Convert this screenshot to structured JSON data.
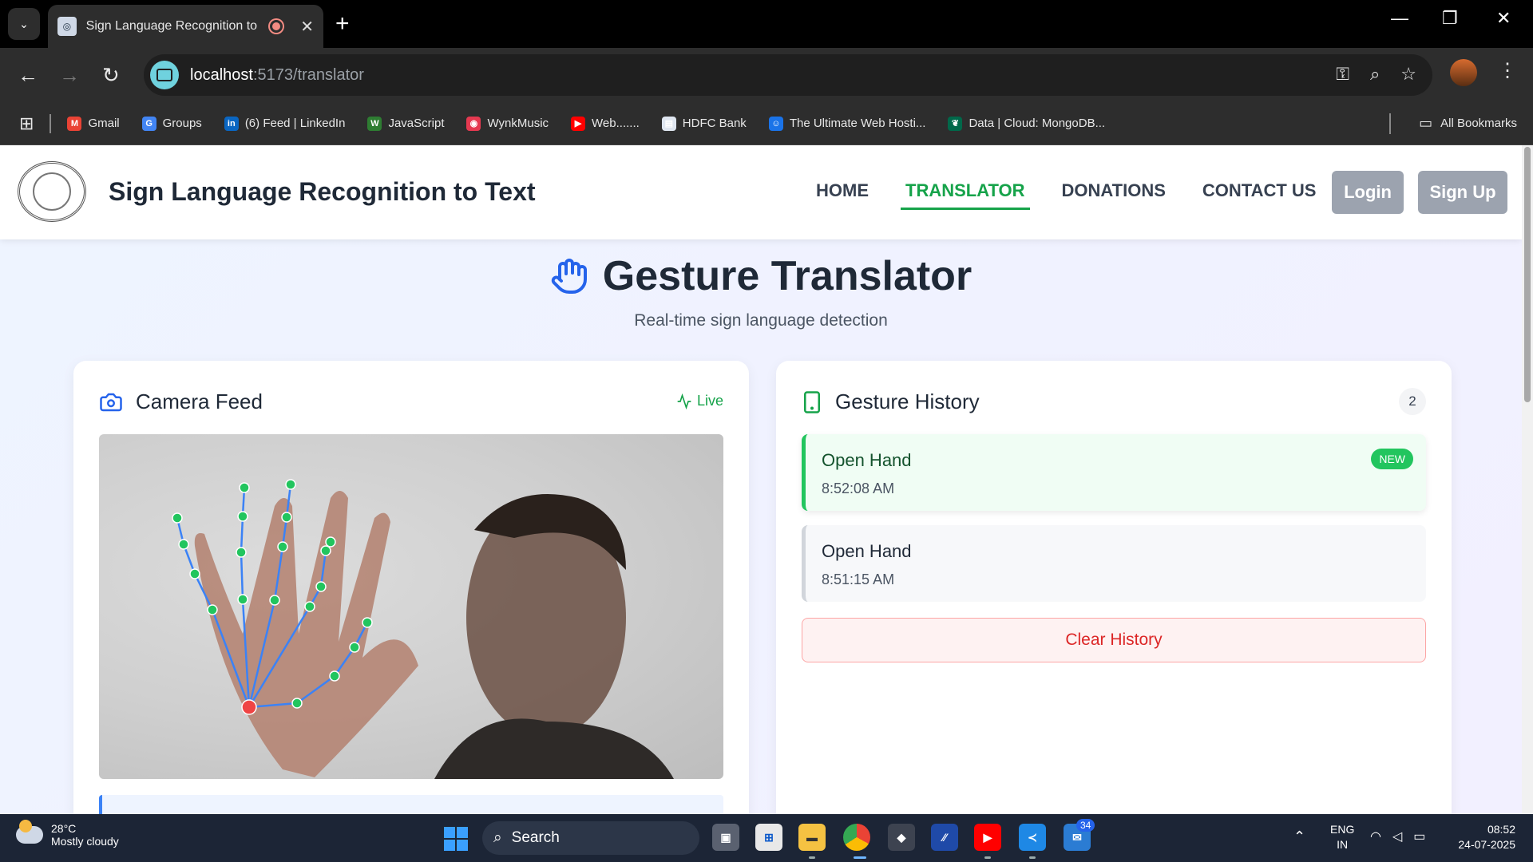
{
  "browser": {
    "tab_title": "Sign Language Recognition to Te",
    "url_host": "localhost",
    "url_path": ":5173/translator",
    "bookmarks": [
      {
        "label": "Gmail",
        "color": "#ea4335",
        "glyph": "M"
      },
      {
        "label": "Groups",
        "color": "#4285f4",
        "glyph": "G"
      },
      {
        "label": "(6) Feed | LinkedIn",
        "color": "#0a66c2",
        "glyph": "in"
      },
      {
        "label": "JavaScript",
        "color": "#2e7d32",
        "glyph": "W"
      },
      {
        "label": "WynkMusic",
        "color": "#e53950",
        "glyph": "◉"
      },
      {
        "label": "Web.......",
        "color": "#ff0000",
        "glyph": "▶"
      },
      {
        "label": "HDFC Bank",
        "color": "#dfe6f0",
        "glyph": "▤"
      },
      {
        "label": "The Ultimate Web Hosti...",
        "color": "#1a73e8",
        "glyph": "☺"
      },
      {
        "label": "Data | Cloud: MongoDB...",
        "color": "#00684a",
        "glyph": "❦"
      }
    ],
    "all_bookmarks": "All Bookmarks"
  },
  "nav": {
    "brand": "Sign Language Recognition to Text",
    "links": [
      "HOME",
      "TRANSLATOR",
      "DONATIONS",
      "CONTACT US"
    ],
    "login": "Login",
    "signup": "Sign Up",
    "active_link": "TRANSLATOR"
  },
  "hero": {
    "title": "Gesture Translator",
    "subtitle": "Real-time sign language detection"
  },
  "camera": {
    "title": "Camera Feed",
    "live": "Live"
  },
  "history": {
    "title": "Gesture History",
    "count": "2",
    "items": [
      {
        "gesture": "Open Hand",
        "time": "8:52:08 AM",
        "badge": "NEW"
      },
      {
        "gesture": "Open Hand",
        "time": "8:51:15 AM"
      }
    ],
    "clear_label": "Clear History"
  },
  "taskbar": {
    "temp": "28°C",
    "weather": "Mostly cloudy",
    "search": "Search",
    "lang_line1": "ENG",
    "lang_line2": "IN",
    "time": "08:52",
    "date": "24-07-2025",
    "badge_count": "34"
  },
  "colors": {
    "accent_green": "#16a34a",
    "accent_blue": "#2563eb",
    "landmark_point": "#22c55e",
    "landmark_wrist": "#ef4444",
    "landmark_line": "#3b82f6"
  }
}
